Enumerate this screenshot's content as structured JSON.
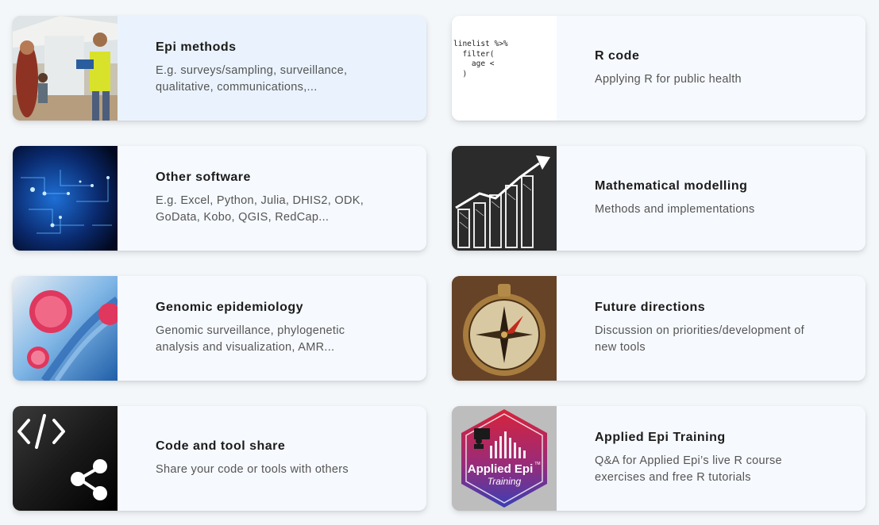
{
  "cards": [
    {
      "title": "Epi methods",
      "desc": "E.g. surveys/sampling, surveillance,\nqualitative, communications,...",
      "icon": "field-survey-photo"
    },
    {
      "title": "R code",
      "desc": "Applying R for public health",
      "icon": "r-code-snippet",
      "code": "linelist %>%\n  filter(\n    age <\n  )"
    },
    {
      "title": "Other software",
      "desc": "E.g. Excel, Python, Julia, DHIS2, ODK,\nGoData, Kobo, QGIS, RedCap...",
      "icon": "circuit-board-photo"
    },
    {
      "title": "Mathematical modelling",
      "desc": "Methods and implementations",
      "icon": "chalkboard-growth-chart"
    },
    {
      "title": "Genomic epidemiology",
      "desc": "Genomic surveillance, phylogenetic\nanalysis and visualization, AMR...",
      "icon": "virus-dna-photo"
    },
    {
      "title": "Future directions",
      "desc": "Discussion on priorities/development of\nnew tools",
      "icon": "compass-photo"
    },
    {
      "title": "Code and tool share",
      "desc": "Share your code or tools with others",
      "icon": "share-icon"
    },
    {
      "title": "Applied Epi Training",
      "desc": "Q&A for Applied Epi’s live R course\nexercises and free R tutorials",
      "icon": "applied-epi-training-logo",
      "logo_line1": "Applied Epi",
      "logo_tm": "TM",
      "logo_line2": "Training"
    }
  ]
}
